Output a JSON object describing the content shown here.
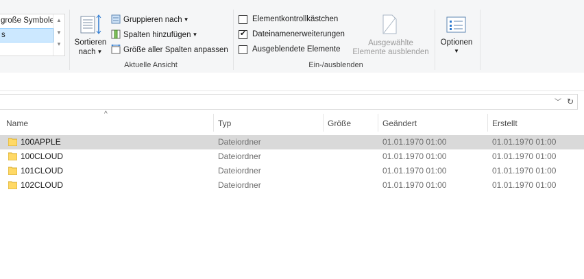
{
  "ribbon": {
    "layout": {
      "items": [
        "große Symbole",
        "s"
      ],
      "selected_index": 1
    },
    "current_view": {
      "sort_label": "Sortieren",
      "sort_label2": "nach",
      "group_by": "Gruppieren nach",
      "add_columns": "Spalten hinzufügen",
      "fit_columns": "Größe aller Spalten anpassen",
      "group_title": "Aktuelle Ansicht"
    },
    "show_hide": {
      "item_checkboxes": "Elementkontrollkästchen",
      "item_checkboxes_checked": false,
      "file_extensions": "Dateinamenerweiterungen",
      "file_extensions_checked": true,
      "hidden_items": "Ausgeblendete Elemente",
      "hidden_items_checked": false,
      "hide_selected_1": "Ausgewählte",
      "hide_selected_2": "Elemente ausblenden",
      "group_title": "Ein-/ausblenden"
    },
    "options": {
      "label": "Optionen"
    }
  },
  "columns": {
    "name": "Name",
    "type": "Typ",
    "size": "Größe",
    "modified": "Geändert",
    "created": "Erstellt"
  },
  "files": [
    {
      "name": "100APPLE",
      "type": "Dateiordner",
      "size": "",
      "modified": "01.01.1970 01:00",
      "created": "01.01.1970 01:00",
      "selected": true
    },
    {
      "name": "100CLOUD",
      "type": "Dateiordner",
      "size": "",
      "modified": "01.01.1970 01:00",
      "created": "01.01.1970 01:00",
      "selected": false
    },
    {
      "name": "101CLOUD",
      "type": "Dateiordner",
      "size": "",
      "modified": "01.01.1970 01:00",
      "created": "01.01.1970 01:00",
      "selected": false
    },
    {
      "name": "102CLOUD",
      "type": "Dateiordner",
      "size": "",
      "modified": "01.01.1970 01:00",
      "created": "01.01.1970 01:00",
      "selected": false
    }
  ],
  "colors": {
    "selection": "#d9d9d9",
    "layout_selection": "#cce8ff",
    "folder_yellow": "#ffd966",
    "accent_blue": "#2b79d0"
  }
}
